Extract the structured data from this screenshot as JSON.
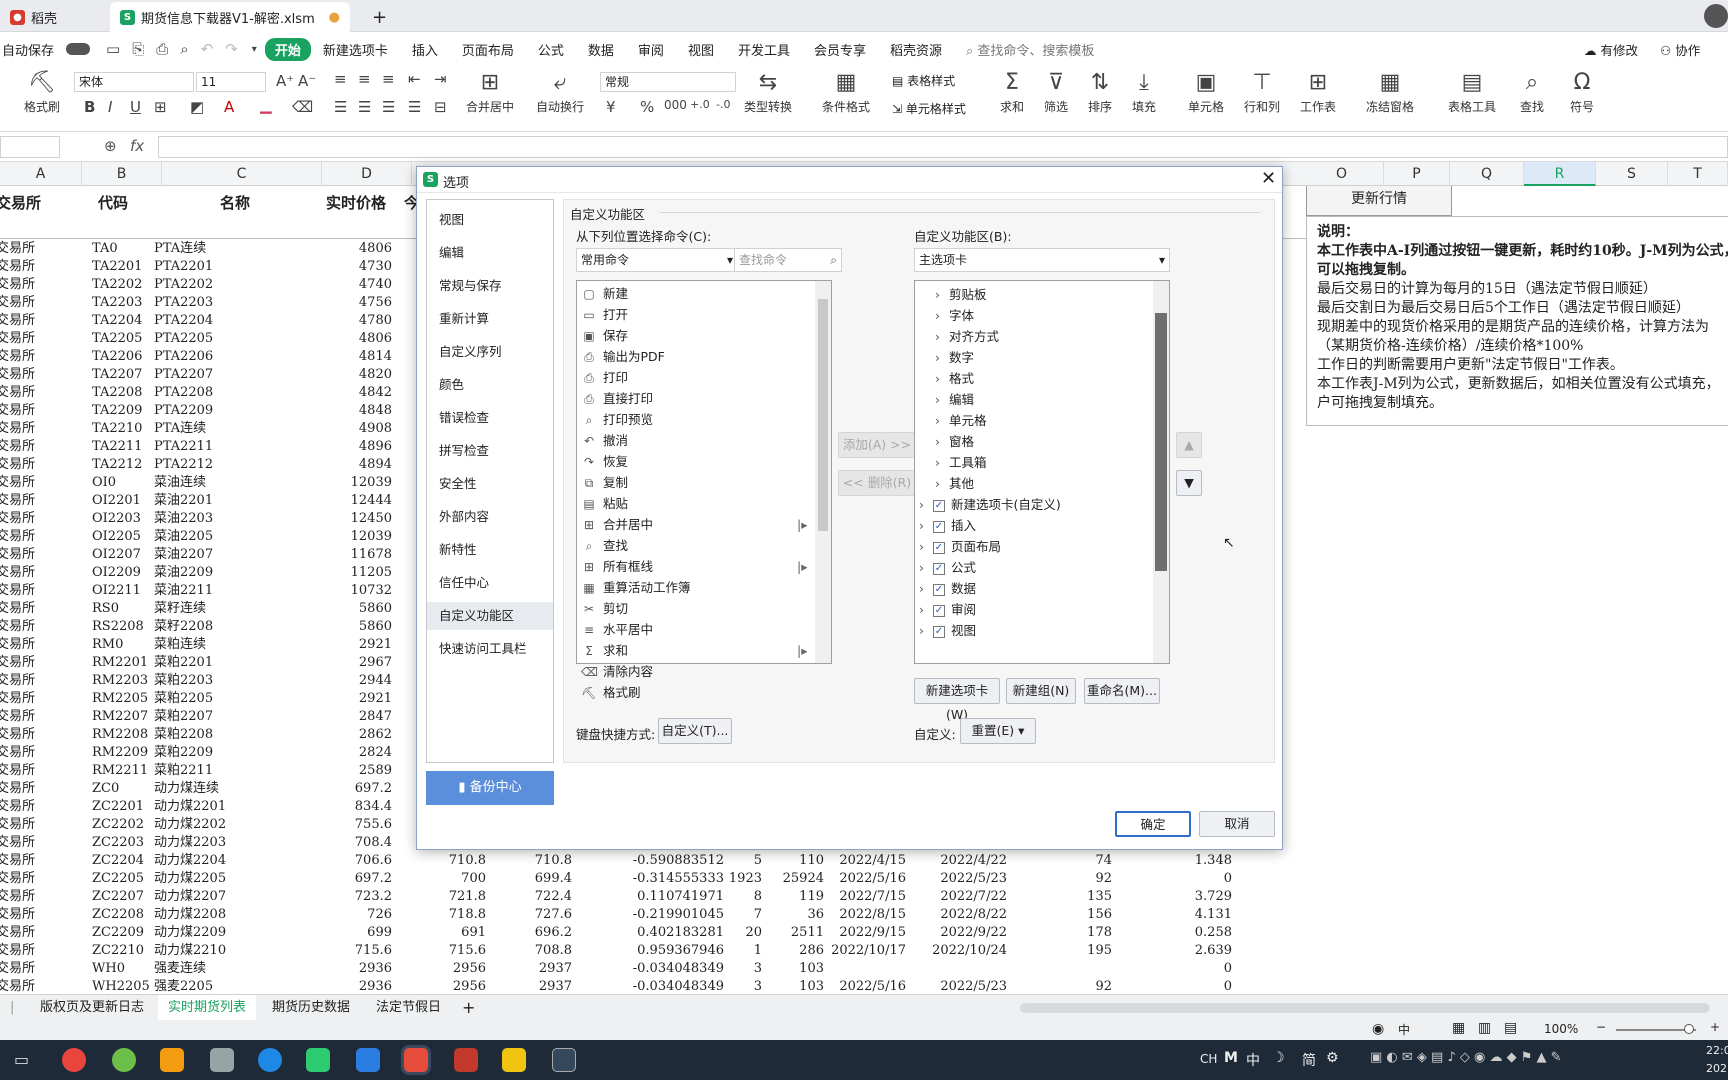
{
  "titlebar": {
    "tab1": "稻壳",
    "tab2": "期货信息下载器V1-解密.xlsm",
    "new_tab": "+"
  },
  "menubar": {
    "autosave": "自动保存",
    "items": [
      "开始",
      "新建选项卡",
      "插入",
      "页面布局",
      "公式",
      "数据",
      "审阅",
      "视图",
      "开发工具",
      "会员专享",
      "稻壳资源"
    ],
    "search": "查找命令、搜索模板",
    "right": [
      "有修改",
      "协作"
    ]
  },
  "ribbon": {
    "format_painter": "格式刷",
    "font": "宋体",
    "size": "11",
    "merge": "合并居中",
    "wrap": "自动换行",
    "numfmt": "常规",
    "convert": "类型转换",
    "cond": "条件格式",
    "table_style": "表格样式",
    "cell_style": "单元格样式",
    "sum": "求和",
    "filter": "筛选",
    "sort": "排序",
    "fill": "填充",
    "cell": "单元格",
    "rowcol": "行和列",
    "sheet": "工作表",
    "freeze": "冻结窗格",
    "tools": "表格工具",
    "find": "查找",
    "symbol": "符号"
  },
  "formula": {
    "fx": "fx"
  },
  "columns": {
    "left": [
      "A",
      "B",
      "C",
      "D"
    ],
    "right": [
      "O",
      "P",
      "Q",
      "R",
      "S",
      "T"
    ]
  },
  "sheet": {
    "headers": [
      "交易所",
      "代码",
      "名称",
      "实时价格",
      "今"
    ],
    "update_btn": "更新行情",
    "notes": [
      "说明：",
      "本工作表中A-I列通过按钮一键更新，耗时约10秒。J-M列为公式，",
      "可以拖拽复制。",
      "最后交易日的计算为每月的15日（遇法定节假日顺延）",
      "最后交割日为最后交易日后5个工作日（遇法定节假日顺延）",
      "现期差中的现货价格采用的是期货产品的连续价格，计算方法为",
      "（某期货价格-连续价格）/连续价格*100%",
      "工作日的判断需要用户更新\"法定节假日\"工作表。",
      "本工作表J-M列为公式，更新数据后，如相关位置没有公式填充，",
      "户可拖拽复制填充。"
    ],
    "rows": [
      [
        "交易所",
        "TA0",
        "PTA连续",
        "4806"
      ],
      [
        "交易所",
        "TA2201",
        "PTA2201",
        "4730"
      ],
      [
        "交易所",
        "TA2202",
        "PTA2202",
        "4740"
      ],
      [
        "交易所",
        "TA2203",
        "PTA2203",
        "4756"
      ],
      [
        "交易所",
        "TA2204",
        "PTA2204",
        "4780"
      ],
      [
        "交易所",
        "TA2205",
        "PTA2205",
        "4806"
      ],
      [
        "交易所",
        "TA2206",
        "PTA2206",
        "4814"
      ],
      [
        "交易所",
        "TA2207",
        "PTA2207",
        "4820"
      ],
      [
        "交易所",
        "TA2208",
        "PTA2208",
        "4842"
      ],
      [
        "交易所",
        "TA2209",
        "PTA2209",
        "4848"
      ],
      [
        "交易所",
        "TA2210",
        "PTA连续",
        "4908"
      ],
      [
        "交易所",
        "TA2211",
        "PTA2211",
        "4896"
      ],
      [
        "交易所",
        "TA2212",
        "PTA2212",
        "4894"
      ],
      [
        "交易所",
        "OI0",
        "菜油连续",
        "12039"
      ],
      [
        "交易所",
        "OI2201",
        "菜油2201",
        "12444"
      ],
      [
        "交易所",
        "OI2203",
        "菜油2203",
        "12450"
      ],
      [
        "交易所",
        "OI2205",
        "菜油2205",
        "12039"
      ],
      [
        "交易所",
        "OI2207",
        "菜油2207",
        "11678"
      ],
      [
        "交易所",
        "OI2209",
        "菜油2209",
        "11205"
      ],
      [
        "交易所",
        "OI2211",
        "菜油2211",
        "10732"
      ],
      [
        "交易所",
        "RS0",
        "菜籽连续",
        "5860"
      ],
      [
        "交易所",
        "RS2208",
        "菜籽2208",
        "5860"
      ],
      [
        "交易所",
        "RM0",
        "菜粕连续",
        "2921"
      ],
      [
        "交易所",
        "RM2201",
        "菜粕2201",
        "2967"
      ],
      [
        "交易所",
        "RM2203",
        "菜粕2203",
        "2944"
      ],
      [
        "交易所",
        "RM2205",
        "菜粕2205",
        "2921"
      ],
      [
        "交易所",
        "RM2207",
        "菜粕2207",
        "2847"
      ],
      [
        "交易所",
        "RM2208",
        "菜粕2208",
        "2862"
      ],
      [
        "交易所",
        "RM2209",
        "菜粕2209",
        "2824"
      ],
      [
        "交易所",
        "RM2211",
        "菜粕2211",
        "2589"
      ],
      [
        "交易所",
        "ZC0",
        "动力煤连续",
        "697.2"
      ],
      [
        "交易所",
        "ZC2201",
        "动力煤2201",
        "834.4"
      ],
      [
        "交易所",
        "ZC2202",
        "动力煤2202",
        "755.6"
      ],
      [
        "交易所",
        "ZC2203",
        "动力煤2203",
        "708.4"
      ]
    ],
    "full_rows": [
      [
        "交易所",
        "ZC2204",
        "动力煤2204",
        "706.6",
        "710.8",
        "710.8",
        "-0.590883512",
        "5",
        "110",
        "2022/4/15",
        "2022/4/22",
        "74",
        "1.348"
      ],
      [
        "交易所",
        "ZC2205",
        "动力煤2205",
        "697.2",
        "700",
        "699.4",
        "-0.314555333",
        "1923",
        "25924",
        "2022/5/16",
        "2022/5/23",
        "92",
        "0"
      ],
      [
        "交易所",
        "ZC2207",
        "动力煤2207",
        "723.2",
        "721.8",
        "722.4",
        "0.110741971",
        "8",
        "119",
        "2022/7/15",
        "2022/7/22",
        "135",
        "3.729"
      ],
      [
        "交易所",
        "ZC2208",
        "动力煤2208",
        "726",
        "718.8",
        "727.6",
        "-0.219901045",
        "7",
        "36",
        "2022/8/15",
        "2022/8/22",
        "156",
        "4.131"
      ],
      [
        "交易所",
        "ZC2209",
        "动力煤2209",
        "699",
        "691",
        "696.2",
        "0.402183281",
        "20",
        "2511",
        "2022/9/15",
        "2022/9/22",
        "178",
        "0.258"
      ],
      [
        "交易所",
        "ZC2210",
        "动力煤2210",
        "715.6",
        "715.6",
        "708.8",
        "0.959367946",
        "1",
        "286",
        "2022/10/17",
        "2022/10/24",
        "195",
        "2.639"
      ],
      [
        "交易所",
        "WH0",
        "强麦连续",
        "2936",
        "2956",
        "2937",
        "-0.034048349",
        "3",
        "103",
        "",
        "",
        "",
        "0"
      ],
      [
        "交易所",
        "WH2205",
        "强麦2205",
        "2936",
        "2956",
        "2937",
        "-0.034048349",
        "3",
        "103",
        "2022/5/16",
        "2022/5/23",
        "92",
        "0"
      ]
    ]
  },
  "sheet_tabs": [
    "版权页及更新日志",
    "实时期货列表",
    "期货历史数据",
    "法定节假日"
  ],
  "status": {
    "zoom": "100%"
  },
  "taskbar": {
    "ime": [
      "CH",
      "M",
      "中",
      "简"
    ],
    "clock": "22:0",
    "date": "202"
  },
  "dialog": {
    "title": "选项",
    "nav": [
      "视图",
      "编辑",
      "常规与保存",
      "重新计算",
      "自定义序列",
      "颜色",
      "错误检查",
      "拼写检查",
      "安全性",
      "外部内容",
      "新特性",
      "信任中心",
      "自定义功能区",
      "快速访问工具栏"
    ],
    "backup": "备份中心",
    "section": "自定义功能区",
    "from_label": "从下列位置选择命令(C):",
    "from_value": "常用命令",
    "search_placeholder": "查找命令",
    "commands": [
      "新建",
      "打开",
      "保存",
      "输出为PDF",
      "打印",
      "直接打印",
      "打印预览",
      "撤消",
      "恢复",
      "复制",
      "粘贴",
      "合并居中",
      "查找",
      "所有框线",
      "重算活动工作簿",
      "剪切",
      "水平居中",
      "求和",
      "清除内容",
      "格式刷"
    ],
    "add_btn": "添加(A) >>",
    "remove_btn": "<< 删除(R)",
    "custom_label": "自定义功能区(B):",
    "custom_value": "主选项卡",
    "tree_groups": [
      "剪贴板",
      "字体",
      "对齐方式",
      "数字",
      "格式",
      "编辑",
      "单元格",
      "窗格",
      "工具箱",
      "其他"
    ],
    "tree_tabs": [
      "新建选项卡(自定义)",
      "插入",
      "页面布局",
      "公式",
      "数据",
      "审阅",
      "视图"
    ],
    "new_tab_btn": "新建选项卡(W)",
    "new_group_btn": "新建组(N)",
    "rename_btn": "重命名(M)...",
    "keyboard_label": "键盘快捷方式:",
    "customize_btn": "自定义(T)...",
    "custom2_label": "自定义:",
    "reset_btn": "重置(E)",
    "ok": "确定",
    "cancel": "取消"
  }
}
